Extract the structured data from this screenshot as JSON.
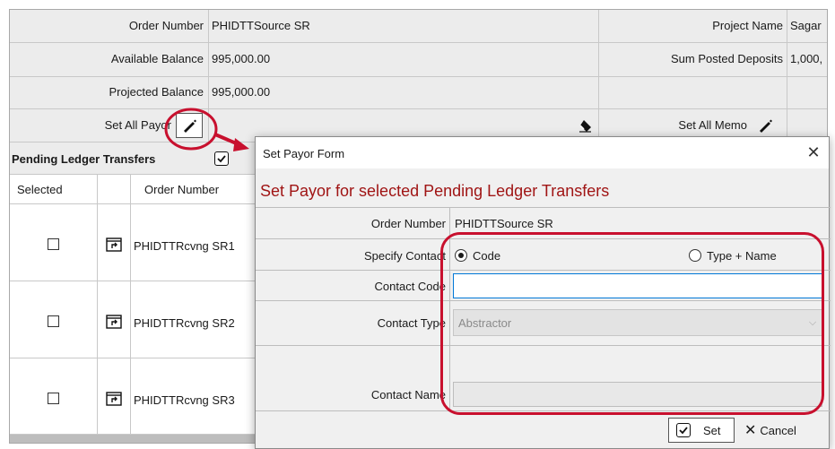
{
  "form": {
    "order_number_label": "Order Number",
    "order_number_value": "PHIDTTSource SR",
    "project_name_label": "Project Name",
    "project_name_value": "Sagar",
    "available_balance_label": "Available Balance",
    "available_balance_value": "995,000.00",
    "sum_posted_deposits_label": "Sum Posted Deposits",
    "sum_posted_deposits_value": "1,000,",
    "projected_balance_label": "Projected Balance",
    "projected_balance_value": "995,000.00",
    "set_all_payor_label": "Set All Payor",
    "set_all_memo_label": "Set All Memo"
  },
  "pending": {
    "title": "Pending Ledger Transfers",
    "columns": [
      "Selected",
      "Order Number"
    ],
    "rows": [
      {
        "selected": false,
        "order_number": "PHIDTTRcvng SR1"
      },
      {
        "selected": false,
        "order_number": "PHIDTTRcvng SR2"
      },
      {
        "selected": false,
        "order_number": "PHIDTTRcvng SR3"
      }
    ]
  },
  "dialog": {
    "window_title": "Set Payor Form",
    "heading": "Set Payor for selected Pending Ledger Transfers",
    "order_number_label": "Order Number",
    "order_number_value": "PHIDTTSource SR",
    "specify_contact_label": "Specify Contact",
    "radio_code_label": "Code",
    "radio_type_name_label": "Type + Name",
    "selected_option": "Code",
    "contact_code_label": "Contact Code",
    "contact_code_value": "",
    "contact_type_label": "Contact Type",
    "contact_type_value": "Abstractor",
    "contact_name_label": "Contact Name",
    "contact_name_value": "",
    "set_button": "Set",
    "cancel_button": "Cancel"
  },
  "colors": {
    "heading": "#a01515",
    "annotation": "#c8102e",
    "focus_border": "#0078d7"
  }
}
